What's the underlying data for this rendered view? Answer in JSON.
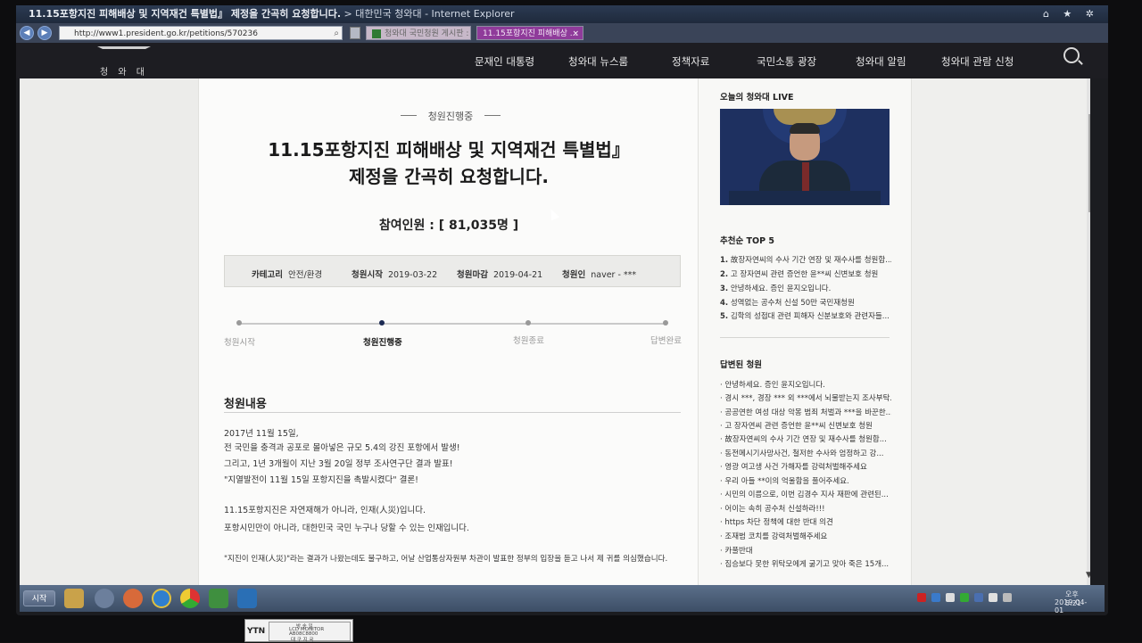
{
  "window": {
    "title": "11.15포항지진 피해배상 및 지역재건 특별법』 제정을 간곡히 요청합니다.",
    "title_suffix": " > 대한민국 청와대 - Internet Explorer",
    "controls": "⌂ ★ ✲"
  },
  "browser": {
    "url": "http://www1.president.go.kr/petitions/570236",
    "tabs": [
      {
        "label": "청와대 국민청원 게시판 : 내...",
        "active": false
      },
      {
        "label": "11.15포항지진 피해배상 ...",
        "active": true
      }
    ]
  },
  "site": {
    "logo_text": "청 와 대",
    "menu": [
      "문재인 대통령",
      "청와대 뉴스룸",
      "정책자료",
      "국민소통 광장",
      "청와대 알림",
      "청와대 관람 신청"
    ]
  },
  "petition": {
    "status": "청원진행중",
    "title_line1": "11.15포항지진 피해배상 및 지역재건 특별법』",
    "title_line2": "제정을 간곡히 요청합니다.",
    "participants": "참여인원 : [ 81,035명 ]",
    "info": {
      "category_label": "카테고리",
      "category": "안전/환경",
      "start_label": "청원시작",
      "start": "2019-03-22",
      "end_label": "청원마감",
      "end": "2019-04-21",
      "author_label": "청원인",
      "author": "naver - ***"
    },
    "steps": [
      "청원시작",
      "청원진행중",
      "청원종료",
      "답변완료"
    ],
    "body_heading": "청원내용",
    "body_lines": [
      "2017년 11월 15일,",
      "전 국민을 충격과 공포로 몰아넣은 규모 5.4의 강진 포항에서 발생!",
      "그리고, 1년 3개월이 지난 3월 20일 정부 조사연구단 결과 발표!",
      "\"지열발전이 11월 15일 포항지진을 촉발시켰다\" 결론!",
      "",
      "11.15포항지진은 자연재해가 아니라, 인재(人災)입니다.",
      "포항시민만이 아니라, 대한민국 국민 누구나 당할 수 있는 인재입니다.",
      "",
      "\"지진이 인재(人災)\"라는 결과가 나왔는데도 불구하고, 어날 산업통상자원부 차관이 발표한 정부의 입장을 듣고 나서 제 귀를 의심했습니다."
    ]
  },
  "sidebar": {
    "live_title": "오늘의 청와대 LIVE",
    "top5_title": "추천순 TOP 5",
    "top5": [
      {
        "n": "1.",
        "t": "故장자연씨의 수사 기간 연장 및 재수사를 청원합..."
      },
      {
        "n": "2.",
        "t": "고 장자연씨 관련 증언한 윤**씨 신변보호 청원"
      },
      {
        "n": "3.",
        "t": "안녕하세요. 증인 윤지오입니다."
      },
      {
        "n": "4.",
        "t": "성역없는 공수처 신설 50만 국민재청원"
      },
      {
        "n": "5.",
        "t": "김학의 성접대 관련 피해자 신분보호와 관련자들..."
      }
    ],
    "answered_title": "답변된 청원",
    "answered": [
      "· 안녕하세요. 증인 윤지오입니다.",
      "· 경시 ***, 경장 *** 외 ***에서 뇌물받는지 조사부탁...",
      "· 공공연한 여성 대상 악몽 범죄 처벌과 ***을 바꾼한...",
      "· 고 장자연씨 관련 증언한 윤**씨 신변보호 청원",
      "· 故장자연씨의 수사 기간 연장 및 재수사를 청원합...",
      "· 동전메시기사망사건, 철저한 수사와 엄정하고 강...",
      "· 영광 여고생 사건 가해자를 강력처벌해주세요",
      "· 우리 아들 **이의 억울함을 풀어주세요.",
      "· 시민의 이름으로, 이번 김경수 지사 재판에 관련된...",
      "· 어이는 속히 공수처 신설하라!!!",
      "· https 차단 정책에 대한 반대 의견",
      "· 조재범 코치를 강력처벌해주세요",
      "· 카풀반대",
      "· 짐승보다 못한 위탁모에게 굶기고 맞아 죽은 15개..."
    ]
  },
  "taskbar": {
    "start": "시작",
    "time": "오후 5:21",
    "date": "2019-04-01"
  },
  "caption": {
    "brand": "YTN",
    "row1": "방 송 일",
    "row2": "LCD MONITOR",
    "row3": "AB08C8800",
    "row4": "대 구 지 국"
  }
}
